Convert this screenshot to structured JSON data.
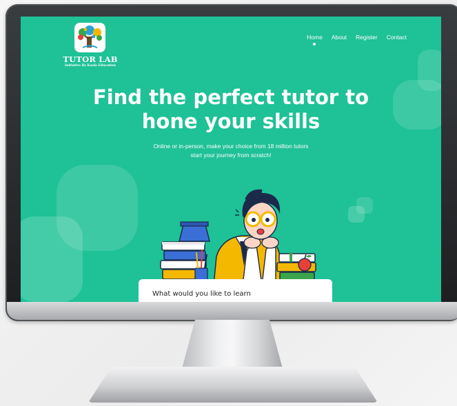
{
  "brand": {
    "name": "TUTOR LAB",
    "tagline": "Initiative By Kaala Education"
  },
  "nav": {
    "items": [
      {
        "label": "Home",
        "active": true
      },
      {
        "label": "About"
      },
      {
        "label": "Register"
      },
      {
        "label": "Contact"
      }
    ]
  },
  "hero": {
    "title_line1": "Find the perfect tutor to",
    "title_line2": "hone your skills",
    "subtitle_line1": "Online or in-person, make your choice from 18 million tutors",
    "subtitle_line2": "start your journey from scratch!"
  },
  "search_card": {
    "label": "What would you like to learn"
  },
  "colors": {
    "primary": "#1fc197",
    "accent_yellow": "#f5b800",
    "frame": "#1c1d1f"
  }
}
